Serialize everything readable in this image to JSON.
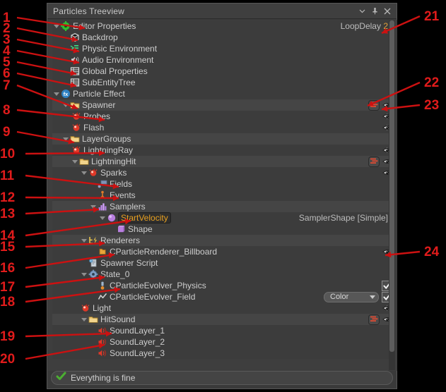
{
  "window": {
    "title": "Particles Treeview",
    "buttons": [
      {
        "name": "menu-chevron",
        "glyph": "▾"
      },
      {
        "name": "pin",
        "glyph": "⚲"
      },
      {
        "name": "close",
        "glyph": "✕"
      }
    ]
  },
  "status": {
    "text": "Everything is fine",
    "icon": "check-icon",
    "color": "#4caf32"
  },
  "accents": {
    "highlight_text": "#e8a020",
    "annotation_red": "#e01b1b",
    "ok_green": "#4caf32",
    "row_alt": "#454545",
    "row_even": "#3c3c3c",
    "row_selected": "#555555"
  },
  "tree": [
    {
      "id": "editor-properties",
      "label": "Editor Properties",
      "indent": 0,
      "icon": "gear-green-icon",
      "twisty": "down",
      "band": "even",
      "meta": {
        "label": "LoopDelay",
        "value": "2"
      }
    },
    {
      "id": "backdrop",
      "label": "Backdrop",
      "indent": 1,
      "icon": "backdrop-cube-icon",
      "twisty": "none",
      "band": "even"
    },
    {
      "id": "physic-environment",
      "label": "Physic Environment",
      "indent": 1,
      "icon": "physics-icon",
      "twisty": "none",
      "band": "even"
    },
    {
      "id": "audio-environment",
      "label": "Audio Environment",
      "indent": 1,
      "icon": "speaker-icon",
      "twisty": "none",
      "band": "even"
    },
    {
      "id": "global-properties",
      "label": "Global Properties",
      "indent": 1,
      "icon": "grid-table-icon",
      "twisty": "none",
      "band": "even"
    },
    {
      "id": "subentitytree",
      "label": "SubEntityTree",
      "indent": 1,
      "icon": "grid-table-icon",
      "twisty": "none",
      "band": "even"
    },
    {
      "id": "particle-effect",
      "label": "Particle Effect",
      "indent": 0,
      "icon": "fx-icon",
      "twisty": "down",
      "band": "even"
    },
    {
      "id": "spawner",
      "label": "Spawner",
      "indent": 1,
      "icon": "folder-icon",
      "twisty": "down",
      "band": "alt",
      "eye": true,
      "listbtn": true
    },
    {
      "id": "probes",
      "label": "Probes",
      "indent": 2,
      "icon": "particle-red-icon",
      "twisty": "right",
      "band": "even",
      "eye": true
    },
    {
      "id": "flash",
      "label": "Flash",
      "indent": 2,
      "icon": "particle-red-icon",
      "twisty": "right",
      "band": "even",
      "eye": true
    },
    {
      "id": "layergroups",
      "label": "LayerGroups",
      "indent": 1,
      "icon": "folder-icon",
      "twisty": "down",
      "band": "alt"
    },
    {
      "id": "lightningray",
      "label": "LightningRay",
      "indent": 2,
      "icon": "particle-red-icon",
      "twisty": "right",
      "band": "even",
      "eye": true
    },
    {
      "id": "lightninghit",
      "label": "LightningHit",
      "indent": 2,
      "icon": "folder-icon",
      "twisty": "down",
      "band": "alt",
      "eye": true,
      "listbtn": true
    },
    {
      "id": "sparks",
      "label": "Sparks",
      "indent": 3,
      "icon": "particle-red-icon",
      "twisty": "down",
      "band": "even",
      "eye": true
    },
    {
      "id": "fields",
      "label": "Fields",
      "indent": 4,
      "icon": "field-icon",
      "twisty": "none",
      "band": "even"
    },
    {
      "id": "events",
      "label": "Events",
      "indent": 4,
      "icon": "events-icon",
      "twisty": "none",
      "band": "even"
    },
    {
      "id": "samplers",
      "label": "Samplers",
      "indent": 4,
      "icon": "samplers-icon",
      "twisty": "down",
      "band": "alt"
    },
    {
      "id": "startvelocity",
      "label": "StartVelocity",
      "indent": 5,
      "icon": "sphere-purple-icon",
      "twisty": "down",
      "band": "even",
      "highlight": true,
      "meta": {
        "label": "SamplerShape [Simple]",
        "value": ""
      }
    },
    {
      "id": "shape",
      "label": "Shape",
      "indent": 6,
      "icon": "cube-purple-icon",
      "twisty": "none",
      "band": "even"
    },
    {
      "id": "renderers",
      "label": "Renderers",
      "indent": 3,
      "icon": "renderers-icon",
      "twisty": "down",
      "band": "alt"
    },
    {
      "id": "cparticlerenderer-billboard",
      "label": "CParticleRenderer_Billboard",
      "indent": 4,
      "icon": "folder-small-icon",
      "twisty": "none",
      "band": "even",
      "eye": true
    },
    {
      "id": "spawner-script",
      "label": "Spawner Script",
      "indent": 3,
      "icon": "script-icon",
      "twisty": "none",
      "band": "even"
    },
    {
      "id": "state-0",
      "label": "State_0",
      "indent": 3,
      "icon": "state-gear-icon",
      "twisty": "down",
      "band": "even"
    },
    {
      "id": "cparticleevolver-physics",
      "label": "CParticleEvolver_Physics",
      "indent": 4,
      "icon": "evolver-physics-icon",
      "twisty": "none",
      "band": "even",
      "checkbox": true
    },
    {
      "id": "cparticleevolver-field",
      "label": "CParticleEvolver_Field",
      "indent": 4,
      "icon": "evolver-field-icon",
      "twisty": "none",
      "band": "even",
      "checkbox": true,
      "combo": "Color"
    },
    {
      "id": "light",
      "label": "Light",
      "indent": 3,
      "icon": "particle-red-icon",
      "twisty": "right",
      "band": "even",
      "eye": true
    },
    {
      "id": "hitsound",
      "label": "HitSound",
      "indent": 3,
      "icon": "folder-icon",
      "twisty": "down",
      "band": "alt",
      "eye": true,
      "listbtn": true
    },
    {
      "id": "soundlayer-1",
      "label": "SoundLayer_1",
      "indent": 4,
      "icon": "sound-red-icon",
      "twisty": "none",
      "band": "even"
    },
    {
      "id": "soundlayer-2",
      "label": "SoundLayer_2",
      "indent": 4,
      "icon": "sound-red-icon",
      "twisty": "none",
      "band": "even"
    },
    {
      "id": "soundlayer-3",
      "label": "SoundLayer_3",
      "indent": 4,
      "icon": "sound-red-icon",
      "twisty": "none",
      "band": "even"
    }
  ],
  "combo_options": [
    "Color"
  ],
  "annotations": {
    "left": [
      "1",
      "2",
      "3",
      "4",
      "5",
      "6",
      "7",
      "8",
      "9",
      "10",
      "11",
      "12",
      "13",
      "14",
      "15",
      "16",
      "17",
      "18",
      "19",
      "20"
    ],
    "right": [
      "21",
      "22",
      "23",
      "24"
    ]
  }
}
